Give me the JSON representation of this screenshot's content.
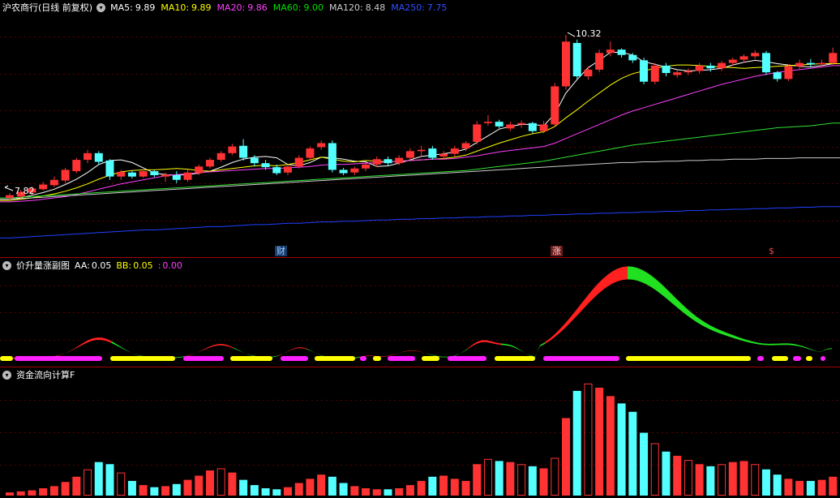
{
  "panel1": {
    "title": "沪农商行(日线 前复权)",
    "ma": [
      {
        "label": "MA5:",
        "value": "9.89",
        "color": "#ffffff"
      },
      {
        "label": "MA10:",
        "value": "9.89",
        "color": "#ffff00"
      },
      {
        "label": "MA20:",
        "value": "9.86",
        "color": "#ff40ff"
      },
      {
        "label": "MA60:",
        "value": "9.00",
        "color": "#00e000"
      },
      {
        "label": "MA120:",
        "value": "8.48",
        "color": "#cccccc"
      },
      {
        "label": "MA250:",
        "value": "7.75",
        "color": "#3050ff"
      }
    ],
    "high_label": "10.32",
    "low_label": "7.82",
    "markers": [
      "财",
      "涨",
      "$"
    ]
  },
  "panel2": {
    "title": "价升量涨副图",
    "aa_label": "AA:",
    "aa_value": "0.05",
    "bb_label": "BB:",
    "bb_value": "0.05",
    "cc_label": ":",
    "cc_value": "0.00"
  },
  "panel3": {
    "title": "资金流向计算F"
  },
  "colors": {
    "up": "#ff3333",
    "down": "#54ffff",
    "border": "#a00000"
  },
  "chart_data": {
    "type": "candlestick",
    "price_range": [
      7.2,
      10.6
    ],
    "candles": [
      [
        7.88,
        7.92,
        7.84,
        7.95
      ],
      [
        7.9,
        7.97,
        7.87,
        8.0
      ],
      [
        7.96,
        8.02,
        7.93,
        8.05
      ],
      [
        8.01,
        8.08,
        7.99,
        8.12
      ],
      [
        8.07,
        8.15,
        8.04,
        8.2
      ],
      [
        8.14,
        8.3,
        8.1,
        8.33
      ],
      [
        8.28,
        8.45,
        8.25,
        8.48
      ],
      [
        8.45,
        8.55,
        8.4,
        8.6
      ],
      [
        8.55,
        8.42,
        8.38,
        8.58
      ],
      [
        8.44,
        8.2,
        8.15,
        8.46
      ],
      [
        8.2,
        8.27,
        8.15,
        8.3
      ],
      [
        8.26,
        8.2,
        8.17,
        8.29
      ],
      [
        8.2,
        8.28,
        8.18,
        8.31
      ],
      [
        8.28,
        8.22,
        8.19,
        8.3
      ],
      [
        8.2,
        8.23,
        8.12,
        8.26
      ],
      [
        8.22,
        8.15,
        8.1,
        8.28
      ],
      [
        8.15,
        8.26,
        8.12,
        8.3
      ],
      [
        8.25,
        8.35,
        8.22,
        8.38
      ],
      [
        8.35,
        8.45,
        8.32,
        8.48
      ],
      [
        8.45,
        8.55,
        8.42,
        8.58
      ],
      [
        8.55,
        8.65,
        8.52,
        8.69
      ],
      [
        8.66,
        8.48,
        8.44,
        8.76
      ],
      [
        8.48,
        8.4,
        8.35,
        8.52
      ],
      [
        8.4,
        8.34,
        8.3,
        8.45
      ],
      [
        8.34,
        8.25,
        8.22,
        8.38
      ],
      [
        8.26,
        8.35,
        8.22,
        8.38
      ],
      [
        8.35,
        8.48,
        8.32,
        8.52
      ],
      [
        8.48,
        8.62,
        8.45,
        8.65
      ],
      [
        8.64,
        8.7,
        8.6,
        8.74
      ],
      [
        8.7,
        8.3,
        8.26,
        8.74
      ],
      [
        8.3,
        8.25,
        8.22,
        8.33
      ],
      [
        8.26,
        8.32,
        8.22,
        8.35
      ],
      [
        8.32,
        8.38,
        8.28,
        8.41
      ],
      [
        8.38,
        8.46,
        8.34,
        8.5
      ],
      [
        8.46,
        8.4,
        8.36,
        8.5
      ],
      [
        8.4,
        8.48,
        8.37,
        8.52
      ],
      [
        8.48,
        8.58,
        8.45,
        8.62
      ],
      [
        8.58,
        8.6,
        8.5,
        8.66
      ],
      [
        8.62,
        8.48,
        8.45,
        8.66
      ],
      [
        8.5,
        8.54,
        8.45,
        8.58
      ],
      [
        8.54,
        8.62,
        8.5,
        8.66
      ],
      [
        8.62,
        8.7,
        8.58,
        8.73
      ],
      [
        8.72,
        8.98,
        8.68,
        9.03
      ],
      [
        9.0,
        9.02,
        8.96,
        9.12
      ],
      [
        9.02,
        8.95,
        8.92,
        9.05
      ],
      [
        8.92,
        8.98,
        8.88,
        9.02
      ],
      [
        8.98,
        9.0,
        8.93,
        9.04
      ],
      [
        9.0,
        8.88,
        8.85,
        9.02
      ],
      [
        8.88,
        8.98,
        8.85,
        9.03
      ],
      [
        8.98,
        9.55,
        8.95,
        9.6
      ],
      [
        9.55,
        10.22,
        9.5,
        10.32
      ],
      [
        10.2,
        9.7,
        9.66,
        10.25
      ],
      [
        9.7,
        9.8,
        9.65,
        9.85
      ],
      [
        9.8,
        10.05,
        9.76,
        10.1
      ],
      [
        10.05,
        10.1,
        10.0,
        10.22
      ],
      [
        10.1,
        10.02,
        9.98,
        10.12
      ],
      [
        10.02,
        9.94,
        9.9,
        10.05
      ],
      [
        9.94,
        9.62,
        9.58,
        9.98
      ],
      [
        9.62,
        9.86,
        9.58,
        9.9
      ],
      [
        9.86,
        9.75,
        9.7,
        9.9
      ],
      [
        9.72,
        9.76,
        9.68,
        9.8
      ],
      [
        9.76,
        9.78,
        9.72,
        9.82
      ],
      [
        9.78,
        9.86,
        9.74,
        9.9
      ],
      [
        9.86,
        9.82,
        9.77,
        9.9
      ],
      [
        9.82,
        9.9,
        9.78,
        9.93
      ],
      [
        9.9,
        9.95,
        9.86,
        9.98
      ],
      [
        9.95,
        10.0,
        9.9,
        10.03
      ],
      [
        10.0,
        10.05,
        9.96,
        10.09
      ],
      [
        10.05,
        9.76,
        9.72,
        10.08
      ],
      [
        9.76,
        9.66,
        9.62,
        9.78
      ],
      [
        9.66,
        9.85,
        9.63,
        9.88
      ],
      [
        9.85,
        9.9,
        9.8,
        9.95
      ],
      [
        9.9,
        9.88,
        9.84,
        9.96
      ],
      [
        9.88,
        9.9,
        9.84,
        9.95
      ],
      [
        9.9,
        10.05,
        9.87,
        10.13
      ]
    ],
    "ma_series": {
      "MA5": [
        7.86,
        7.88,
        7.92,
        7.96,
        8.01,
        8.08,
        8.16,
        8.26,
        8.38,
        8.44,
        8.45,
        8.41,
        8.33,
        8.25,
        8.23,
        8.22,
        8.23,
        8.25,
        8.28,
        8.34,
        8.41,
        8.46,
        8.49,
        8.5,
        8.48,
        8.38,
        8.36,
        8.41,
        8.49,
        8.48,
        8.46,
        8.43,
        8.42,
        8.35,
        8.36,
        8.4,
        8.45,
        8.5,
        8.52,
        8.54,
        8.57,
        8.61,
        8.71,
        8.81,
        8.91,
        8.95,
        8.98,
        8.98,
        8.96,
        9.14,
        9.45,
        9.65,
        9.83,
        9.94,
        10.06,
        10.06,
        10.02,
        9.92,
        9.88,
        9.84,
        9.8,
        9.78,
        9.79,
        9.8,
        9.82,
        9.87,
        9.91,
        9.94,
        9.92,
        9.89,
        9.87,
        9.85,
        9.84,
        9.86,
        9.89
      ],
      "MA10": [
        7.84,
        7.86,
        7.88,
        7.91,
        7.94,
        7.98,
        8.03,
        8.09,
        8.16,
        8.22,
        8.27,
        8.29,
        8.3,
        8.3,
        8.31,
        8.32,
        8.31,
        8.29,
        8.28,
        8.3,
        8.32,
        8.34,
        8.36,
        8.37,
        8.36,
        8.38,
        8.41,
        8.45,
        8.49,
        8.46,
        8.43,
        8.42,
        8.44,
        8.43,
        8.42,
        8.43,
        8.44,
        8.45,
        8.46,
        8.47,
        8.49,
        8.52,
        8.58,
        8.64,
        8.7,
        8.75,
        8.8,
        8.84,
        8.87,
        8.95,
        9.08,
        9.2,
        9.33,
        9.45,
        9.57,
        9.67,
        9.74,
        9.78,
        9.82,
        9.85,
        9.87,
        9.87,
        9.86,
        9.85,
        9.84,
        9.83,
        9.82,
        9.83,
        9.84,
        9.85,
        9.86,
        9.87,
        9.88,
        9.89,
        9.89
      ],
      "MA20": [
        7.82,
        7.83,
        7.84,
        7.86,
        7.88,
        7.9,
        7.93,
        7.97,
        8.01,
        8.05,
        8.09,
        8.12,
        8.15,
        8.18,
        8.21,
        8.23,
        8.24,
        8.26,
        8.27,
        8.28,
        8.29,
        8.3,
        8.31,
        8.32,
        8.32,
        8.33,
        8.34,
        8.35,
        8.37,
        8.38,
        8.38,
        8.39,
        8.4,
        8.41,
        8.42,
        8.43,
        8.44,
        8.45,
        8.46,
        8.46,
        8.47,
        8.49,
        8.51,
        8.54,
        8.57,
        8.59,
        8.61,
        8.63,
        8.65,
        8.7,
        8.77,
        8.84,
        8.91,
        8.98,
        9.05,
        9.12,
        9.18,
        9.23,
        9.28,
        9.33,
        9.38,
        9.43,
        9.48,
        9.53,
        9.58,
        9.62,
        9.66,
        9.7,
        9.73,
        9.76,
        9.78,
        9.8,
        9.82,
        9.84,
        9.86
      ],
      "MA60": [
        7.88,
        7.89,
        7.9,
        7.91,
        7.92,
        7.93,
        7.94,
        7.95,
        7.96,
        7.97,
        7.98,
        7.99,
        8.0,
        8.01,
        8.02,
        8.03,
        8.04,
        8.05,
        8.06,
        8.07,
        8.08,
        8.09,
        8.1,
        8.11,
        8.12,
        8.13,
        8.14,
        8.15,
        8.16,
        8.17,
        8.18,
        8.19,
        8.2,
        8.21,
        8.22,
        8.23,
        8.24,
        8.25,
        8.26,
        8.27,
        8.28,
        8.29,
        8.31,
        8.33,
        8.35,
        8.37,
        8.39,
        8.41,
        8.43,
        8.46,
        8.49,
        8.52,
        8.55,
        8.58,
        8.61,
        8.64,
        8.67,
        8.69,
        8.71,
        8.73,
        8.75,
        8.77,
        8.79,
        8.81,
        8.83,
        8.85,
        8.87,
        8.89,
        8.91,
        8.93,
        8.94,
        8.95,
        8.96,
        8.98,
        9.0
      ],
      "MA120": [
        7.86,
        7.87,
        7.88,
        7.89,
        7.9,
        7.91,
        7.92,
        7.93,
        7.94,
        7.95,
        7.96,
        7.97,
        7.98,
        7.99,
        8.0,
        8.01,
        8.02,
        8.03,
        8.04,
        8.05,
        8.06,
        8.07,
        8.08,
        8.09,
        8.1,
        8.11,
        8.12,
        8.13,
        8.14,
        8.15,
        8.16,
        8.17,
        8.18,
        8.19,
        8.2,
        8.21,
        8.22,
        8.23,
        8.24,
        8.25,
        8.26,
        8.27,
        8.28,
        8.29,
        8.3,
        8.31,
        8.32,
        8.33,
        8.34,
        8.35,
        8.36,
        8.37,
        8.38,
        8.39,
        8.4,
        8.41,
        8.41,
        8.42,
        8.42,
        8.43,
        8.43,
        8.44,
        8.44,
        8.45,
        8.45,
        8.46,
        8.46,
        8.46,
        8.47,
        8.47,
        8.47,
        8.48,
        8.48,
        8.48,
        8.48
      ],
      "MA250": [
        7.28,
        7.29,
        7.3,
        7.31,
        7.32,
        7.33,
        7.34,
        7.35,
        7.36,
        7.37,
        7.38,
        7.39,
        7.4,
        7.4,
        7.41,
        7.42,
        7.43,
        7.44,
        7.45,
        7.45,
        7.46,
        7.47,
        7.48,
        7.48,
        7.49,
        7.5,
        7.5,
        7.51,
        7.52,
        7.52,
        7.53,
        7.53,
        7.54,
        7.55,
        7.55,
        7.56,
        7.56,
        7.57,
        7.57,
        7.58,
        7.58,
        7.59,
        7.59,
        7.6,
        7.6,
        7.61,
        7.61,
        7.62,
        7.62,
        7.63,
        7.63,
        7.64,
        7.64,
        7.65,
        7.65,
        7.66,
        7.66,
        7.67,
        7.67,
        7.68,
        7.68,
        7.69,
        7.69,
        7.7,
        7.7,
        7.71,
        7.71,
        7.72,
        7.72,
        7.73,
        7.73,
        7.74,
        7.74,
        7.75,
        7.75
      ]
    },
    "volume": [
      3,
      4,
      5,
      7,
      9,
      13,
      18,
      25,
      32,
      30,
      22,
      14,
      10,
      8,
      9,
      11,
      15,
      19,
      24,
      26,
      22,
      15,
      10,
      7,
      6,
      8,
      12,
      16,
      20,
      18,
      12,
      9,
      7,
      6,
      6,
      7,
      10,
      14,
      18,
      19,
      16,
      14,
      30,
      35,
      33,
      32,
      30,
      28,
      26,
      36,
      74,
      100,
      107,
      103,
      95,
      88,
      80,
      60,
      50,
      42,
      38,
      34,
      30,
      28,
      30,
      32,
      33,
      30,
      25,
      20,
      16,
      14,
      14,
      15,
      18
    ]
  }
}
